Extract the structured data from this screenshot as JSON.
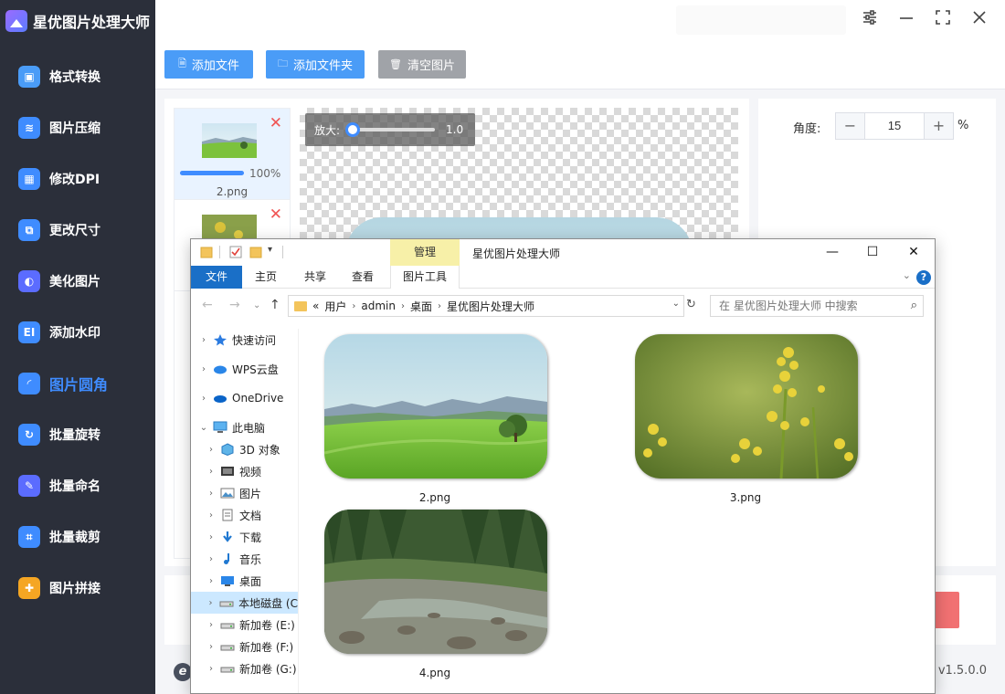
{
  "app": {
    "title": "星优图片处理大师",
    "version": "v1.5.0.0"
  },
  "sidebar": {
    "items": [
      {
        "label": "格式转换",
        "icon": "image-convert-icon",
        "color": "#4a9cf7",
        "glyph": "▣"
      },
      {
        "label": "图片压缩",
        "icon": "compress-icon",
        "color": "#3f8cff",
        "glyph": "≋"
      },
      {
        "label": "修改DPI",
        "icon": "dpi-icon",
        "color": "#3f8cff",
        "glyph": "▦"
      },
      {
        "label": "更改尺寸",
        "icon": "resize-icon",
        "color": "#3f8cff",
        "glyph": "⧉"
      },
      {
        "label": "美化图片",
        "icon": "beautify-icon",
        "color": "#5b6cff",
        "glyph": "◐"
      },
      {
        "label": "添加水印",
        "icon": "watermark-icon",
        "color": "#3f8cff",
        "glyph": "EI"
      },
      {
        "label": "图片圆角",
        "icon": "round-corner-icon",
        "color": "#3f8cff",
        "glyph": "◜",
        "active": true
      },
      {
        "label": "批量旋转",
        "icon": "rotate-icon",
        "color": "#3f8cff",
        "glyph": "↻"
      },
      {
        "label": "批量命名",
        "icon": "rename-icon",
        "color": "#5b6cff",
        "glyph": "✎"
      },
      {
        "label": "批量裁剪",
        "icon": "crop-icon",
        "color": "#3f8cff",
        "glyph": "⌗"
      },
      {
        "label": "图片拼接",
        "icon": "puzzle-icon",
        "color": "#f5a623",
        "glyph": "✚"
      }
    ]
  },
  "toolbar": {
    "add_file": "添加文件",
    "add_folder": "添加文件夹",
    "clear_images": "清空图片"
  },
  "filelist": [
    {
      "name": "2.png",
      "progress": 100,
      "progress_text": "100%",
      "selected": true
    }
  ],
  "preview": {
    "zoom_label": "放大:",
    "zoom_value": "1.0"
  },
  "settings": {
    "angle_label": "角度:",
    "angle_value": "15",
    "angle_unit": "%",
    "minus": "−",
    "plus": "+"
  },
  "explorer": {
    "title": "星优图片处理大师",
    "manage_tab": "管理",
    "ribbon_tabs": [
      "文件",
      "主页",
      "共享",
      "查看"
    ],
    "tool_tab": "图片工具",
    "breadcrumb": [
      "用户",
      "admin",
      "桌面",
      "星优图片处理大师"
    ],
    "breadcrumb_prefix": "«",
    "search_placeholder": "在 星优图片处理大师 中搜索",
    "tree": [
      {
        "label": "快速访问",
        "icon": "star-icon",
        "chev": "›"
      },
      {
        "label": "WPS云盘",
        "icon": "cloud-icon",
        "chev": "›"
      },
      {
        "label": "OneDrive",
        "icon": "onedrive-icon",
        "chev": "›"
      },
      {
        "label": "此电脑",
        "icon": "pc-icon",
        "chev": "⌄"
      },
      {
        "label": "3D 对象",
        "icon": "cube-icon",
        "chev": "›"
      },
      {
        "label": "视频",
        "icon": "video-icon",
        "chev": "›"
      },
      {
        "label": "图片",
        "icon": "pictures-icon",
        "chev": "›"
      },
      {
        "label": "文档",
        "icon": "documents-icon",
        "chev": "›"
      },
      {
        "label": "下载",
        "icon": "download-icon",
        "chev": "›"
      },
      {
        "label": "音乐",
        "icon": "music-icon",
        "chev": "›"
      },
      {
        "label": "桌面",
        "icon": "desktop-icon",
        "chev": "›"
      },
      {
        "label": "本地磁盘 (C",
        "icon": "drive-icon",
        "chev": "›",
        "selected": true
      },
      {
        "label": "新加卷 (E:)",
        "icon": "drive-icon",
        "chev": "›"
      },
      {
        "label": "新加卷 (F:)",
        "icon": "drive-icon",
        "chev": "›"
      },
      {
        "label": "新加卷 (G:)",
        "icon": "drive-icon",
        "chev": "›"
      }
    ],
    "files": [
      {
        "name": "2.png",
        "scene": "meadow"
      },
      {
        "name": "3.png",
        "scene": "flowers"
      },
      {
        "name": "4.png",
        "scene": "river"
      }
    ]
  }
}
